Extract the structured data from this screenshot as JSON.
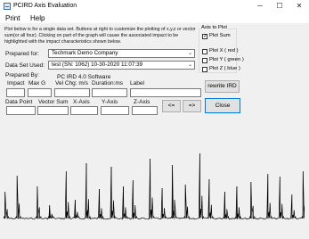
{
  "window": {
    "title": "PCIRD Axis Evaluation",
    "minimize": "─",
    "maximize": "☐",
    "close": "✕"
  },
  "menu": {
    "items": [
      "Print",
      "Help"
    ]
  },
  "description": "Plot below is for a single data set.  Buttons at right to customize the plotting of x,y,z or vector sum(or all four).  Clicking on part of the graph will cause the associated impact to be highlighted with the impact characteristics shown below.",
  "form": {
    "prepared_for_label": "Prepared for:",
    "prepared_for_value": "Techmark Demo Company",
    "data_set_label": "Data Set Used:",
    "data_set_value": "test (SN: 1062) 10-30-2020 11:07:39",
    "prepared_by_label": "Prepared By:",
    "prepared_by_value": "PC IRD 4.0 Software"
  },
  "axis_group": {
    "title": "Axis to Plot",
    "options": [
      {
        "label": "Plot Sum",
        "checked": true
      },
      {
        "label": "Plot X ( red )",
        "checked": false
      },
      {
        "label": "Plot Y ( green )",
        "checked": false
      },
      {
        "label": "Plot Z ( blue )",
        "checked": false
      }
    ]
  },
  "impact_fields": {
    "impact": "Impact",
    "max_g": "Max G",
    "vel_chg": "Vel Chg: m/s",
    "duration": "Duration:ms",
    "label": "Label"
  },
  "point_fields": {
    "data_point": "Data Point",
    "vector_sum": "Vector Sum",
    "x_axis": "X-Axis",
    "y_axis": "Y-Axis",
    "z_axis": "Z-Axis"
  },
  "buttons": {
    "rewrite": "rewrite IRD",
    "prev": "<=",
    "next": "=>",
    "close": "Close"
  },
  "chart_data": {
    "type": "line",
    "title": "",
    "xlabel": "",
    "ylabel": "",
    "grid": false,
    "series": [
      {
        "color": "#000000",
        "peaks": [
          {
            "x": 0.005,
            "h": 0.3
          },
          {
            "x": 0.045,
            "h": 0.48
          },
          {
            "x": 0.112,
            "h": 0.36
          },
          {
            "x": 0.153,
            "h": 0.15
          },
          {
            "x": 0.208,
            "h": 0.53
          },
          {
            "x": 0.238,
            "h": 0.21
          },
          {
            "x": 0.275,
            "h": 0.62
          },
          {
            "x": 0.318,
            "h": 0.33
          },
          {
            "x": 0.358,
            "h": 0.58
          },
          {
            "x": 0.398,
            "h": 0.36
          },
          {
            "x": 0.43,
            "h": 0.43
          },
          {
            "x": 0.487,
            "h": 0.67
          },
          {
            "x": 0.527,
            "h": 0.34
          },
          {
            "x": 0.561,
            "h": 0.6
          },
          {
            "x": 0.604,
            "h": 0.38
          },
          {
            "x": 0.652,
            "h": 0.73
          },
          {
            "x": 0.683,
            "h": 0.44
          },
          {
            "x": 0.735,
            "h": 0.3
          },
          {
            "x": 0.775,
            "h": 0.36
          },
          {
            "x": 0.822,
            "h": 0.41
          },
          {
            "x": 0.878,
            "h": 0.5
          },
          {
            "x": 0.918,
            "h": 0.47
          },
          {
            "x": 0.958,
            "h": 0.27
          },
          {
            "x": 0.995,
            "h": 0.53
          }
        ]
      }
    ]
  }
}
